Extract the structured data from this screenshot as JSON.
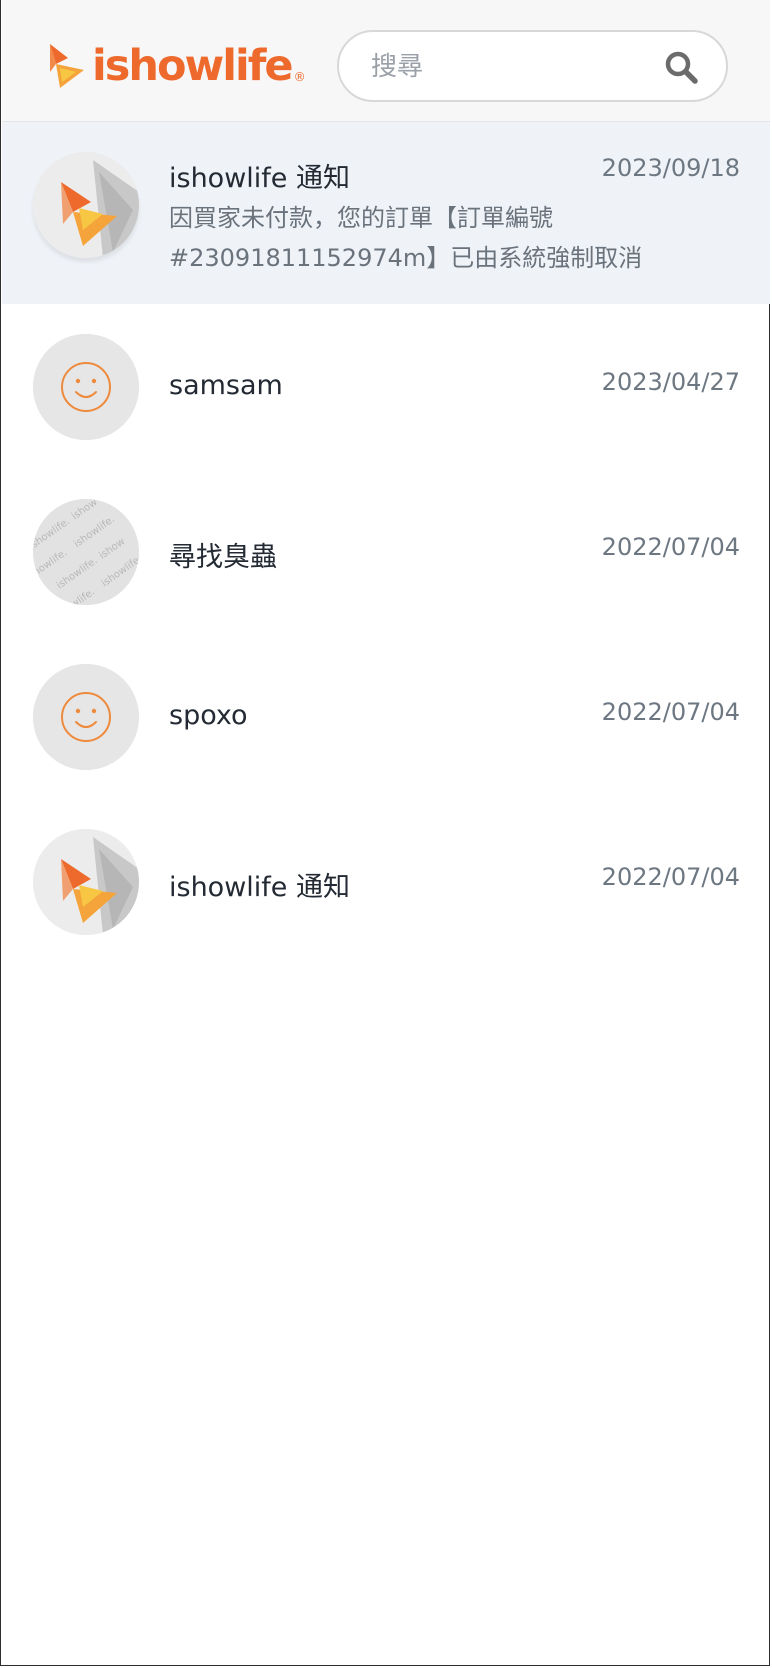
{
  "header": {
    "logo_text": "ishowlife",
    "logo_reg": "®",
    "search_placeholder": "搜尋",
    "search_icon": "search-icon"
  },
  "colors": {
    "brand_orange": "#ee6a2c",
    "selected_row_bg": "#eff3f8",
    "header_bg": "#f7f7f8"
  },
  "conversations": [
    {
      "name": "ishowlife 通知",
      "date": "2023/09/18",
      "preview_line1": "因買家未付款，您的訂單【訂單編號",
      "preview_line2": "#23091811152974m】已由系統強制取消",
      "avatar": "ishowlife-logo-avatar",
      "selected": true
    },
    {
      "name": "samsam",
      "date": "2023/04/27",
      "avatar": "smiley-avatar"
    },
    {
      "name": "尋找臭蟲",
      "date": "2022/07/04",
      "avatar": "watermark-pattern-avatar",
      "avatar_pattern_text": "ishowlife."
    },
    {
      "name": "spoxo",
      "date": "2022/07/04",
      "avatar": "smiley-avatar"
    },
    {
      "name": "ishowlife 通知",
      "date": "2022/07/04",
      "avatar": "ishowlife-logo-avatar"
    }
  ]
}
